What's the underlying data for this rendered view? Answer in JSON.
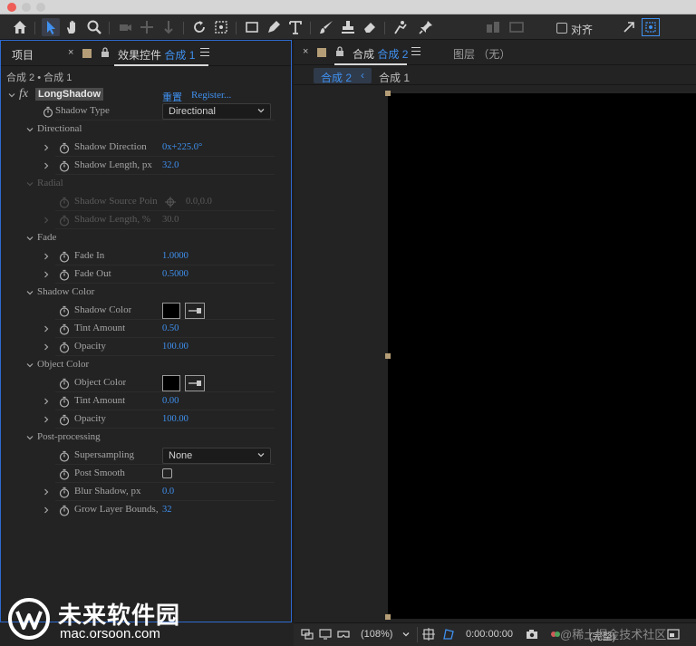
{
  "toolbar": {
    "align_label": "对齐",
    "tools": [
      "home-icon",
      "selection-icon",
      "hand-icon",
      "zoom-icon",
      "orbit-camera-icon",
      "pan-camera-icon",
      "dolly-camera-icon",
      "rotate-icon",
      "pan-behind-icon",
      "rectangle-icon",
      "pen-icon",
      "type-icon",
      "brush-icon",
      "clone-stamp-icon",
      "eraser-icon",
      "roto-brush-icon",
      "puppet-pin-icon"
    ]
  },
  "left_panel": {
    "tab_project": "项目",
    "tab_effects_prefix": "效果控件",
    "tab_effects_comp": "合成 1",
    "breadcrumb": "合成 2 • 合成 1",
    "effect": {
      "fx": "fx",
      "name": "LongShadow",
      "reset": "重置",
      "register": "Register..."
    },
    "rows": {
      "shadow_type": {
        "label": "Shadow Type",
        "value": "Directional"
      },
      "directional": {
        "label": "Directional"
      },
      "shadow_direction": {
        "label": "Shadow Direction",
        "value": "0x+225.0°"
      },
      "shadow_length_px": {
        "label": "Shadow Length, px",
        "value": "32.0"
      },
      "radial": {
        "label": "Radial"
      },
      "shadow_source_point": {
        "label": "Shadow Source Poin",
        "value": "0.0,0.0"
      },
      "shadow_length_pct": {
        "label": "Shadow Length, %",
        "value": "30.0"
      },
      "fade": {
        "label": "Fade"
      },
      "fade_in": {
        "label": "Fade In",
        "value": "1.0000"
      },
      "fade_out": {
        "label": "Fade Out",
        "value": "0.5000"
      },
      "shadow_color_group": {
        "label": "Shadow Color"
      },
      "shadow_color": {
        "label": "Shadow Color"
      },
      "shadow_tint": {
        "label": "Tint Amount",
        "value": "0.50"
      },
      "shadow_opacity": {
        "label": "Opacity",
        "value": "100.00"
      },
      "object_color_group": {
        "label": "Object Color"
      },
      "object_color": {
        "label": "Object Color"
      },
      "object_tint": {
        "label": "Tint Amount",
        "value": "0.00"
      },
      "object_opacity": {
        "label": "Opacity",
        "value": "100.00"
      },
      "post_processing": {
        "label": "Post-processing"
      },
      "supersampling": {
        "label": "Supersampling",
        "value": "None"
      },
      "post_smooth": {
        "label": "Post Smooth"
      },
      "blur_shadow": {
        "label": "Blur Shadow, px",
        "value": "0.0"
      },
      "grow_layer_bounds": {
        "label": "Grow Layer Bounds,",
        "value": "32"
      }
    }
  },
  "right_panel": {
    "tab_comp_prefix": "合成",
    "tab_comp_name": "合成 2",
    "tab_layer": "图层 （无）",
    "sub_tab_active": "合成 2",
    "sub_tab_other": "合成 1",
    "canvas_color": "#000000"
  },
  "bottom_bar": {
    "zoom": "(108%)",
    "timecode": "0:00:00:00",
    "quality": "(完整)"
  },
  "watermark": {
    "site_name": "未来软件园",
    "site_url": "mac.orsoon.com",
    "community": "@稀土掘金技术社区"
  },
  "colors": {
    "accent_blue": "#3f90ef",
    "panel_bg": "#232323",
    "handle": "#b59e77"
  }
}
